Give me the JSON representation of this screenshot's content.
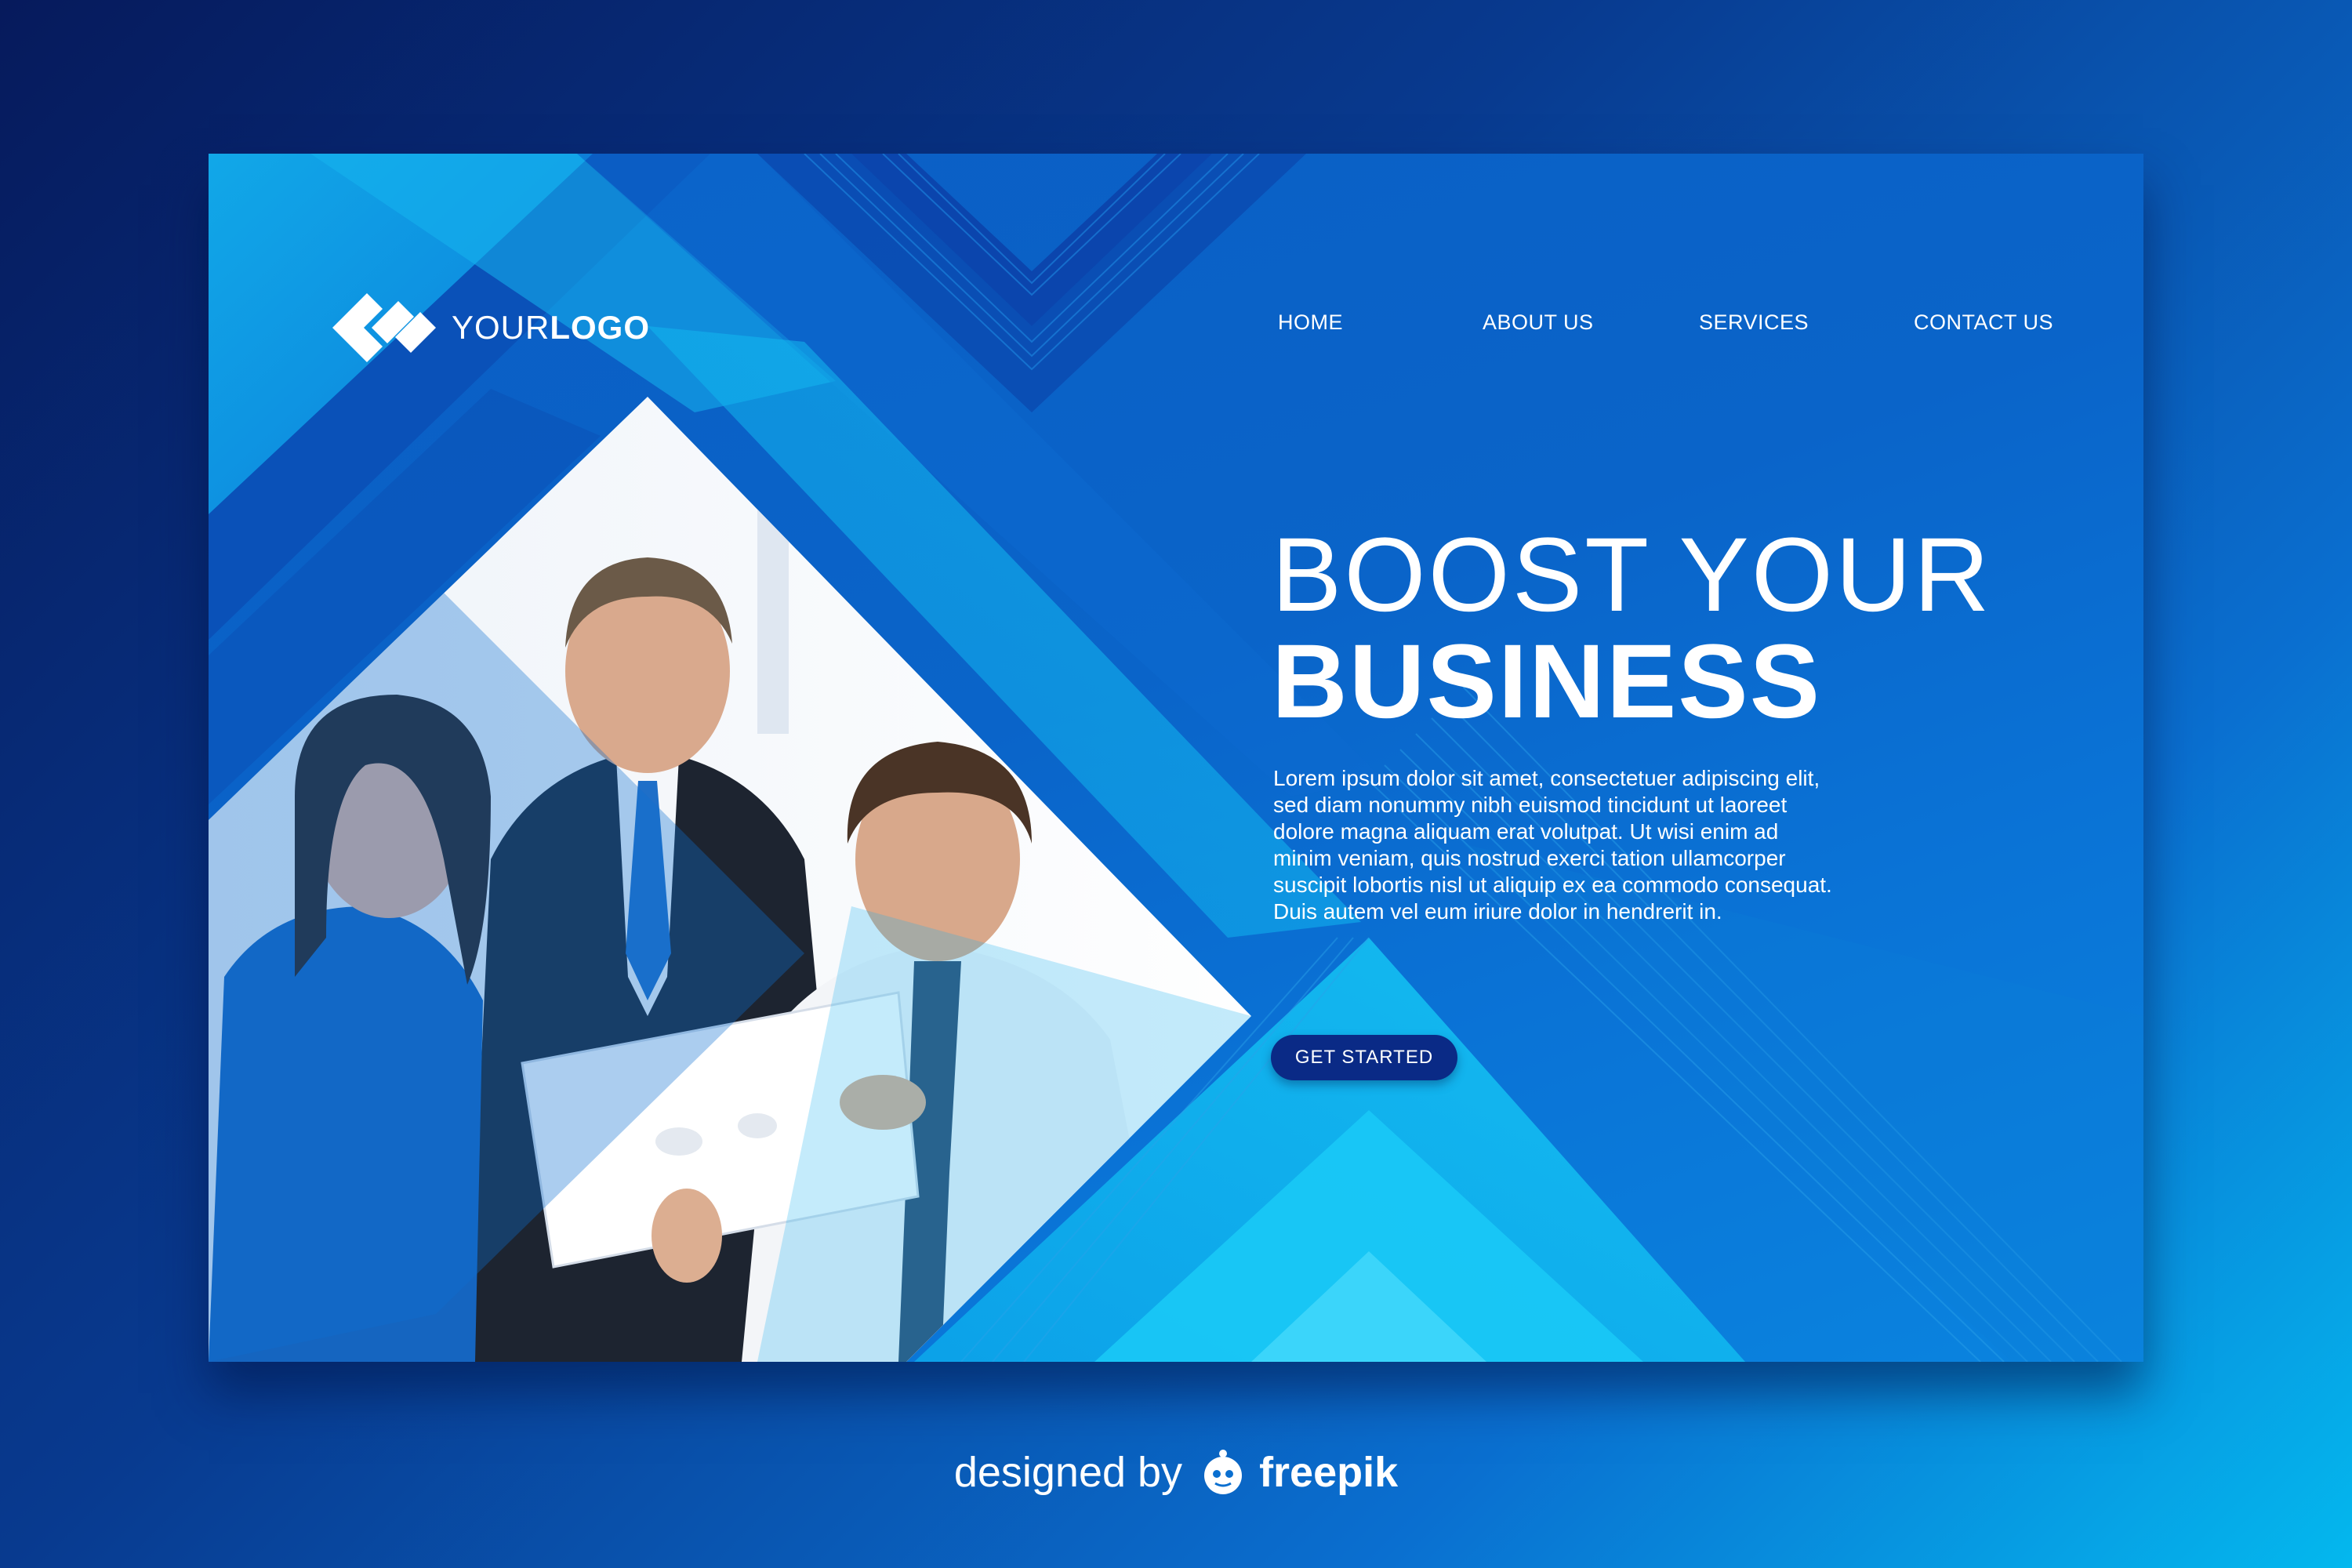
{
  "logo": {
    "text_light": "YOUR",
    "text_bold": "LOGO",
    "icon": "logo-diamond-icon"
  },
  "nav": [
    {
      "label": "HOME"
    },
    {
      "label": "ABOUT US"
    },
    {
      "label": "SERVICES"
    },
    {
      "label": "CONTACT US"
    }
  ],
  "hero": {
    "line1": "BOOST YOUR",
    "line2": "BUSINESS",
    "body": "Lorem ipsum dolor sit amet, consectetuer adipiscing elit,\nsed diam nonummy nibh euismod tincidunt ut laoreet\ndolore magna aliquam erat volutpat. Ut wisi enim ad\nminim veniam, quis nostrud exerci tation ullamcorper\nsuscipit lobortis nisl ut aliquip ex ea commodo consequat.\nDuis autem vel eum iriure dolor in hendrerit in.",
    "cta_label": "GET STARTED"
  },
  "credit": {
    "prefix": "designed by",
    "brand": "freepik",
    "icon": "freepik-mascot-icon"
  },
  "colors": {
    "accent": "#0a2a86",
    "cyan": "#16c3f2",
    "deep_blue": "#0b3fa6"
  }
}
